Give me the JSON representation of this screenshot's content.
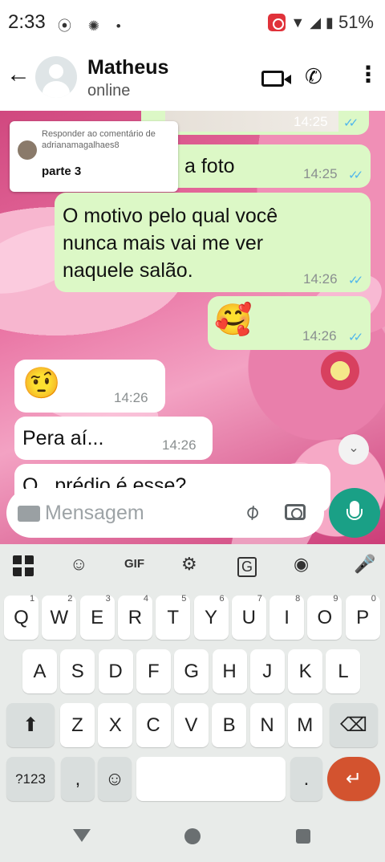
{
  "status_bar": {
    "time": "2:33",
    "battery": "51%",
    "left_icons": "⦿ ✺ •"
  },
  "header": {
    "contact_name": "Matheus",
    "contact_status": "online"
  },
  "messages": [
    {
      "id": "photo",
      "time": "14:25"
    },
    {
      "id": "foto",
      "text": "a foto",
      "time": "14:25"
    },
    {
      "id": "motivo",
      "text": "O motivo pelo qual você nunca mais vai me ver naquele salão.",
      "time": "14:26"
    },
    {
      "id": "emoji-love",
      "emoji": "🥰",
      "time": "14:26"
    },
    {
      "id": "emoji-think",
      "emoji": "🤨",
      "time": "14:26"
    },
    {
      "id": "pera",
      "text": "Pera aí...",
      "time": "14:26"
    },
    {
      "id": "cutoff",
      "text": "O...prédio é esse?"
    }
  ],
  "reply_card": {
    "header": "Responder ao comentário de adrianamagalhaes8",
    "body": "parte 3"
  },
  "input": {
    "placeholder": "Mensagem"
  },
  "keyboard": {
    "toolbar": {
      "gif": "GIF"
    },
    "row1": [
      {
        "k": "Q",
        "n": "1"
      },
      {
        "k": "W",
        "n": "2"
      },
      {
        "k": "E",
        "n": "3"
      },
      {
        "k": "R",
        "n": "4"
      },
      {
        "k": "T",
        "n": "5"
      },
      {
        "k": "Y",
        "n": "6"
      },
      {
        "k": "U",
        "n": "7"
      },
      {
        "k": "I",
        "n": "8"
      },
      {
        "k": "O",
        "n": "9"
      },
      {
        "k": "P",
        "n": "0"
      }
    ],
    "row2": [
      "A",
      "S",
      "D",
      "F",
      "G",
      "H",
      "J",
      "K",
      "L"
    ],
    "row3": [
      "Z",
      "X",
      "C",
      "V",
      "B",
      "N",
      "M"
    ],
    "row4": {
      "symbols": "?123",
      "comma": ",",
      "period": "."
    }
  },
  "colors": {
    "accent": "#1aa086",
    "outgoing": "#dcf8c6",
    "enter": "#d3532f"
  }
}
